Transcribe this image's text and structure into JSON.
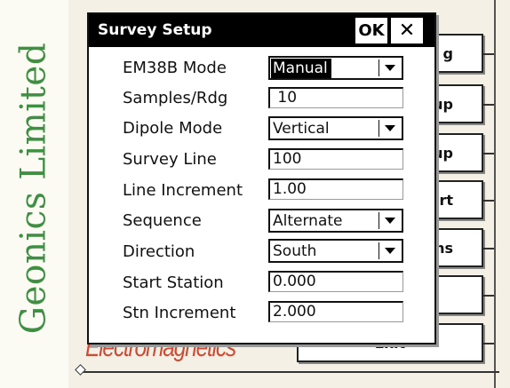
{
  "brand": {
    "company": "Geonics Limited",
    "tagline": "Electromagnetics"
  },
  "menu": {
    "buttons": [
      {
        "label": "g"
      },
      {
        "label": "up"
      },
      {
        "label": "up"
      },
      {
        "label": "rt"
      },
      {
        "label": "ons"
      },
      {
        "label": ""
      },
      {
        "label": "Exit"
      }
    ]
  },
  "dialog": {
    "title": "Survey Setup",
    "ok_label": "OK",
    "close_label": "✕",
    "rows": [
      {
        "label": "EM38B Mode",
        "value": "Manual",
        "type": "select",
        "highlighted": true
      },
      {
        "label": "Samples/Rdg",
        "value": " 10",
        "type": "input"
      },
      {
        "label": "Dipole Mode",
        "value": "Vertical",
        "type": "select"
      },
      {
        "label": "Survey Line",
        "value": "100",
        "type": "input"
      },
      {
        "label": "Line Increment",
        "value": "1.00",
        "type": "input"
      },
      {
        "label": "Sequence",
        "value": "Alternate",
        "type": "select"
      },
      {
        "label": "Direction",
        "value": "South",
        "type": "select"
      },
      {
        "label": "Start Station",
        "value": "0.000",
        "type": "input"
      },
      {
        "label": "Stn Increment",
        "value": "2.000",
        "type": "input"
      }
    ]
  },
  "icons": {
    "dropdown": "chevron-down-icon",
    "close": "close-icon"
  },
  "colors": {
    "brand_green": "#3f8f43",
    "tagline_red": "#cf4a32",
    "titlebar": "#000000"
  }
}
